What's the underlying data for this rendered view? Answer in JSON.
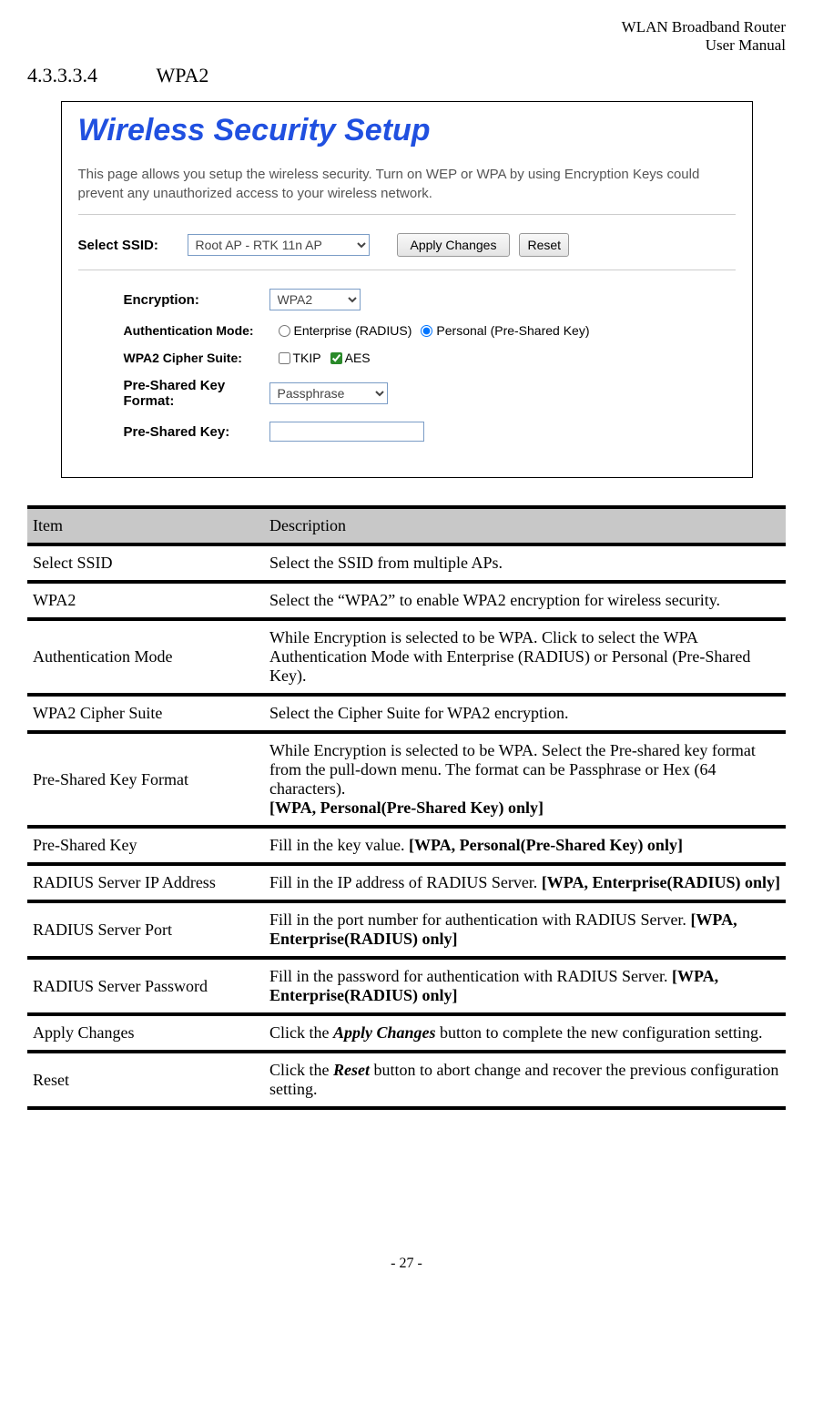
{
  "header": {
    "line1": "WLAN  Broadband  Router",
    "line2": "User  Manual"
  },
  "section": {
    "num": "4.3.3.3.4",
    "title": "WPA2"
  },
  "ss": {
    "title": "Wireless Security Setup",
    "desc": "This page allows you setup the wireless security. Turn on WEP or WPA by using Encryption Keys could prevent any unauthorized access to your wireless network.",
    "selectSSIDLabel": "Select SSID:",
    "selectSSIDValue": "Root AP - RTK 11n AP",
    "applyBtn": "Apply Changes",
    "resetBtn": "Reset",
    "encLabel": "Encryption:",
    "encValue": "WPA2",
    "authLabel": "Authentication Mode:",
    "authOpt1": "Enterprise (RADIUS)",
    "authOpt2": "Personal (Pre-Shared Key)",
    "cipherLabel": "WPA2 Cipher Suite:",
    "cipherOpt1": "TKIP",
    "cipherOpt2": "AES",
    "pskFormatLabel": "Pre-Shared Key Format:",
    "pskFormatValue": "Passphrase",
    "pskLabel": "Pre-Shared Key:"
  },
  "tbl": {
    "h1": "Item",
    "h2": "Description",
    "r0a": "Select SSID",
    "r0b": "Select the SSID from multiple APs.",
    "r1a": "WPA2",
    "r1b": "Select the “WPA2” to enable WPA2 encryption for wireless security.",
    "r2a": "Authentication Mode",
    "r2b": "While Encryption is selected to be WPA. Click to select the WPA Authentication Mode with Enterprise (RADIUS) or Personal (Pre-Shared Key).",
    "r3a": "WPA2 Cipher Suite",
    "r3b": "Select the Cipher Suite for WPA2 encryption.",
    "r4a": "Pre-Shared Key Format",
    "r4b_1": "While Encryption is selected to be WPA. Select the Pre-shared key format from the pull-down menu. The format can be Passphrase or Hex (64 characters).",
    "r4b_2": "[WPA, Personal(Pre-Shared Key) only]",
    "r5a": "Pre-Shared Key",
    "r5b_1": "Fill in the key value. ",
    "r5b_2": "[WPA, Personal(Pre-Shared Key) only]",
    "r6a": "RADIUS Server IP Address",
    "r6b_1": "Fill in the IP address of RADIUS Server. ",
    "r6b_2": "[WPA, Enterprise(RADIUS) only]",
    "r7a": "RADIUS Server Port",
    "r7b_1": "Fill in the port number for authentication with RADIUS Server. ",
    "r7b_2": "[WPA, Enterprise(RADIUS) only]",
    "r8a": "RADIUS Server Password",
    "r8b_1": "Fill in the password for authentication with RADIUS Server. ",
    "r8b_2": "[WPA, Enterprise(RADIUS) only]",
    "r9a": "Apply Changes",
    "r9b_1": "Click the ",
    "r9b_2": "Apply Changes",
    "r9b_3": " button to complete the new configuration setting.",
    "r10a": "Reset",
    "r10b_1": "Click the ",
    "r10b_2": "Reset",
    "r10b_3": " button to abort change and recover the previous configuration setting."
  },
  "footer": "- 27 -"
}
